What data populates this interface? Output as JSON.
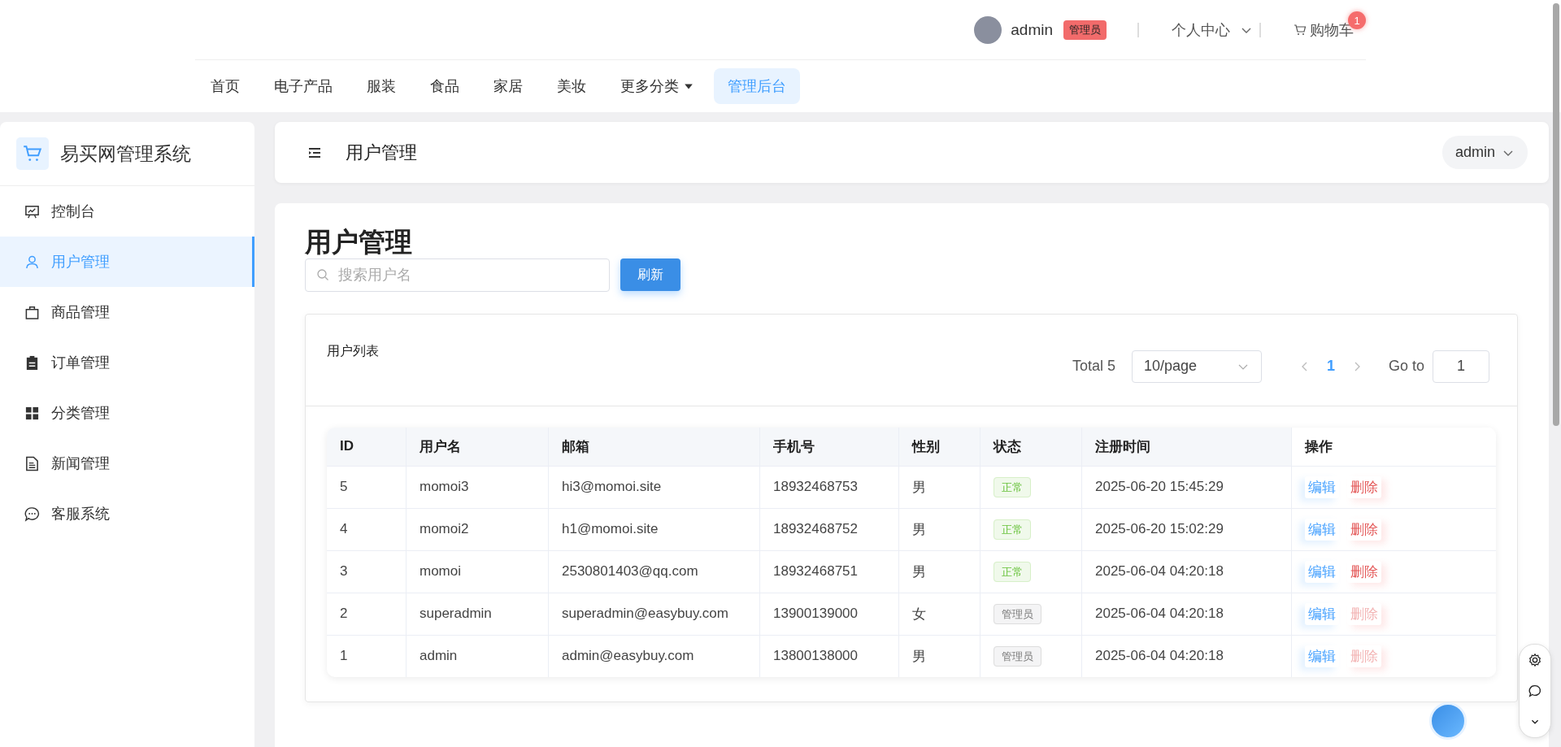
{
  "top_bar": {
    "user": "admin",
    "role_badge": "管理员",
    "personal_center": "个人中心",
    "cart": {
      "label": "购物车",
      "badge": "1"
    }
  },
  "nav": [
    {
      "label": "首页",
      "kind": "link",
      "selected": false
    },
    {
      "label": "电子产品",
      "kind": "link",
      "selected": false
    },
    {
      "label": "服装",
      "kind": "link",
      "selected": false
    },
    {
      "label": "食品",
      "kind": "link",
      "selected": false
    },
    {
      "label": "家居",
      "kind": "link",
      "selected": false
    },
    {
      "label": "美妆",
      "kind": "link",
      "selected": false
    },
    {
      "label": "更多分类",
      "kind": "dropdown",
      "selected": false
    },
    {
      "label": "管理后台",
      "kind": "link",
      "selected": true
    }
  ],
  "sidebar": {
    "title": "易买网管理系统",
    "items": [
      {
        "label": "控制台",
        "selected": false
      },
      {
        "label": "用户管理",
        "selected": true
      },
      {
        "label": "商品管理",
        "selected": false
      },
      {
        "label": "订单管理",
        "selected": false
      },
      {
        "label": "分类管理",
        "selected": false
      },
      {
        "label": "新闻管理",
        "selected": false
      },
      {
        "label": "客服系统",
        "selected": false
      }
    ]
  },
  "header": {
    "title": "用户管理",
    "user_menu": "admin"
  },
  "page": {
    "title": "用户管理",
    "search": {
      "placeholder": "搜索用户名"
    },
    "refresh_button": "刷新"
  },
  "table_card": {
    "title": "用户列表",
    "pagination": {
      "total": "Total 5",
      "page_size": "10/page",
      "pages": [
        {
          "label": "1",
          "selected": true
        }
      ],
      "goto_label": "Go to",
      "goto_value": "1"
    }
  },
  "table": {
    "columns": [
      "ID",
      "用户名",
      "邮箱",
      "手机号",
      "性别",
      "状态",
      "注册时间",
      "操作"
    ],
    "rows": [
      {
        "id": "5",
        "username": "momoi3",
        "email": "hi3@momoi.site",
        "phone": "18932468753",
        "gender": "男",
        "status": {
          "label": "正常",
          "kind": "normal"
        },
        "registered": "2025-06-20 15:45:29",
        "actions": [
          {
            "label": "编辑",
            "kind": "edit",
            "disabled": false
          },
          {
            "label": "删除",
            "kind": "delete",
            "disabled": false
          }
        ]
      },
      {
        "id": "4",
        "username": "momoi2",
        "email": "h1@momoi.site",
        "phone": "18932468752",
        "gender": "男",
        "status": {
          "label": "正常",
          "kind": "normal"
        },
        "registered": "2025-06-20 15:02:29",
        "actions": [
          {
            "label": "编辑",
            "kind": "edit",
            "disabled": false
          },
          {
            "label": "删除",
            "kind": "delete",
            "disabled": false
          }
        ]
      },
      {
        "id": "3",
        "username": "momoi",
        "email": "2530801403@qq.com",
        "phone": "18932468751",
        "gender": "男",
        "status": {
          "label": "正常",
          "kind": "normal"
        },
        "registered": "2025-06-04 04:20:18",
        "actions": [
          {
            "label": "编辑",
            "kind": "edit",
            "disabled": false
          },
          {
            "label": "删除",
            "kind": "delete",
            "disabled": false
          }
        ]
      },
      {
        "id": "2",
        "username": "superadmin",
        "email": "superadmin@easybuy.com",
        "phone": "13900139000",
        "gender": "女",
        "status": {
          "label": "管理员",
          "kind": "admin"
        },
        "registered": "2025-06-04 04:20:18",
        "actions": [
          {
            "label": "编辑",
            "kind": "edit",
            "disabled": false
          },
          {
            "label": "删除",
            "kind": "delete",
            "disabled": true
          }
        ]
      },
      {
        "id": "1",
        "username": "admin",
        "email": "admin@easybuy.com",
        "phone": "13800138000",
        "gender": "男",
        "status": {
          "label": "管理员",
          "kind": "admin"
        },
        "registered": "2025-06-04 04:20:18",
        "actions": [
          {
            "label": "编辑",
            "kind": "edit",
            "disabled": false
          },
          {
            "label": "删除",
            "kind": "delete",
            "disabled": true
          }
        ]
      }
    ]
  }
}
